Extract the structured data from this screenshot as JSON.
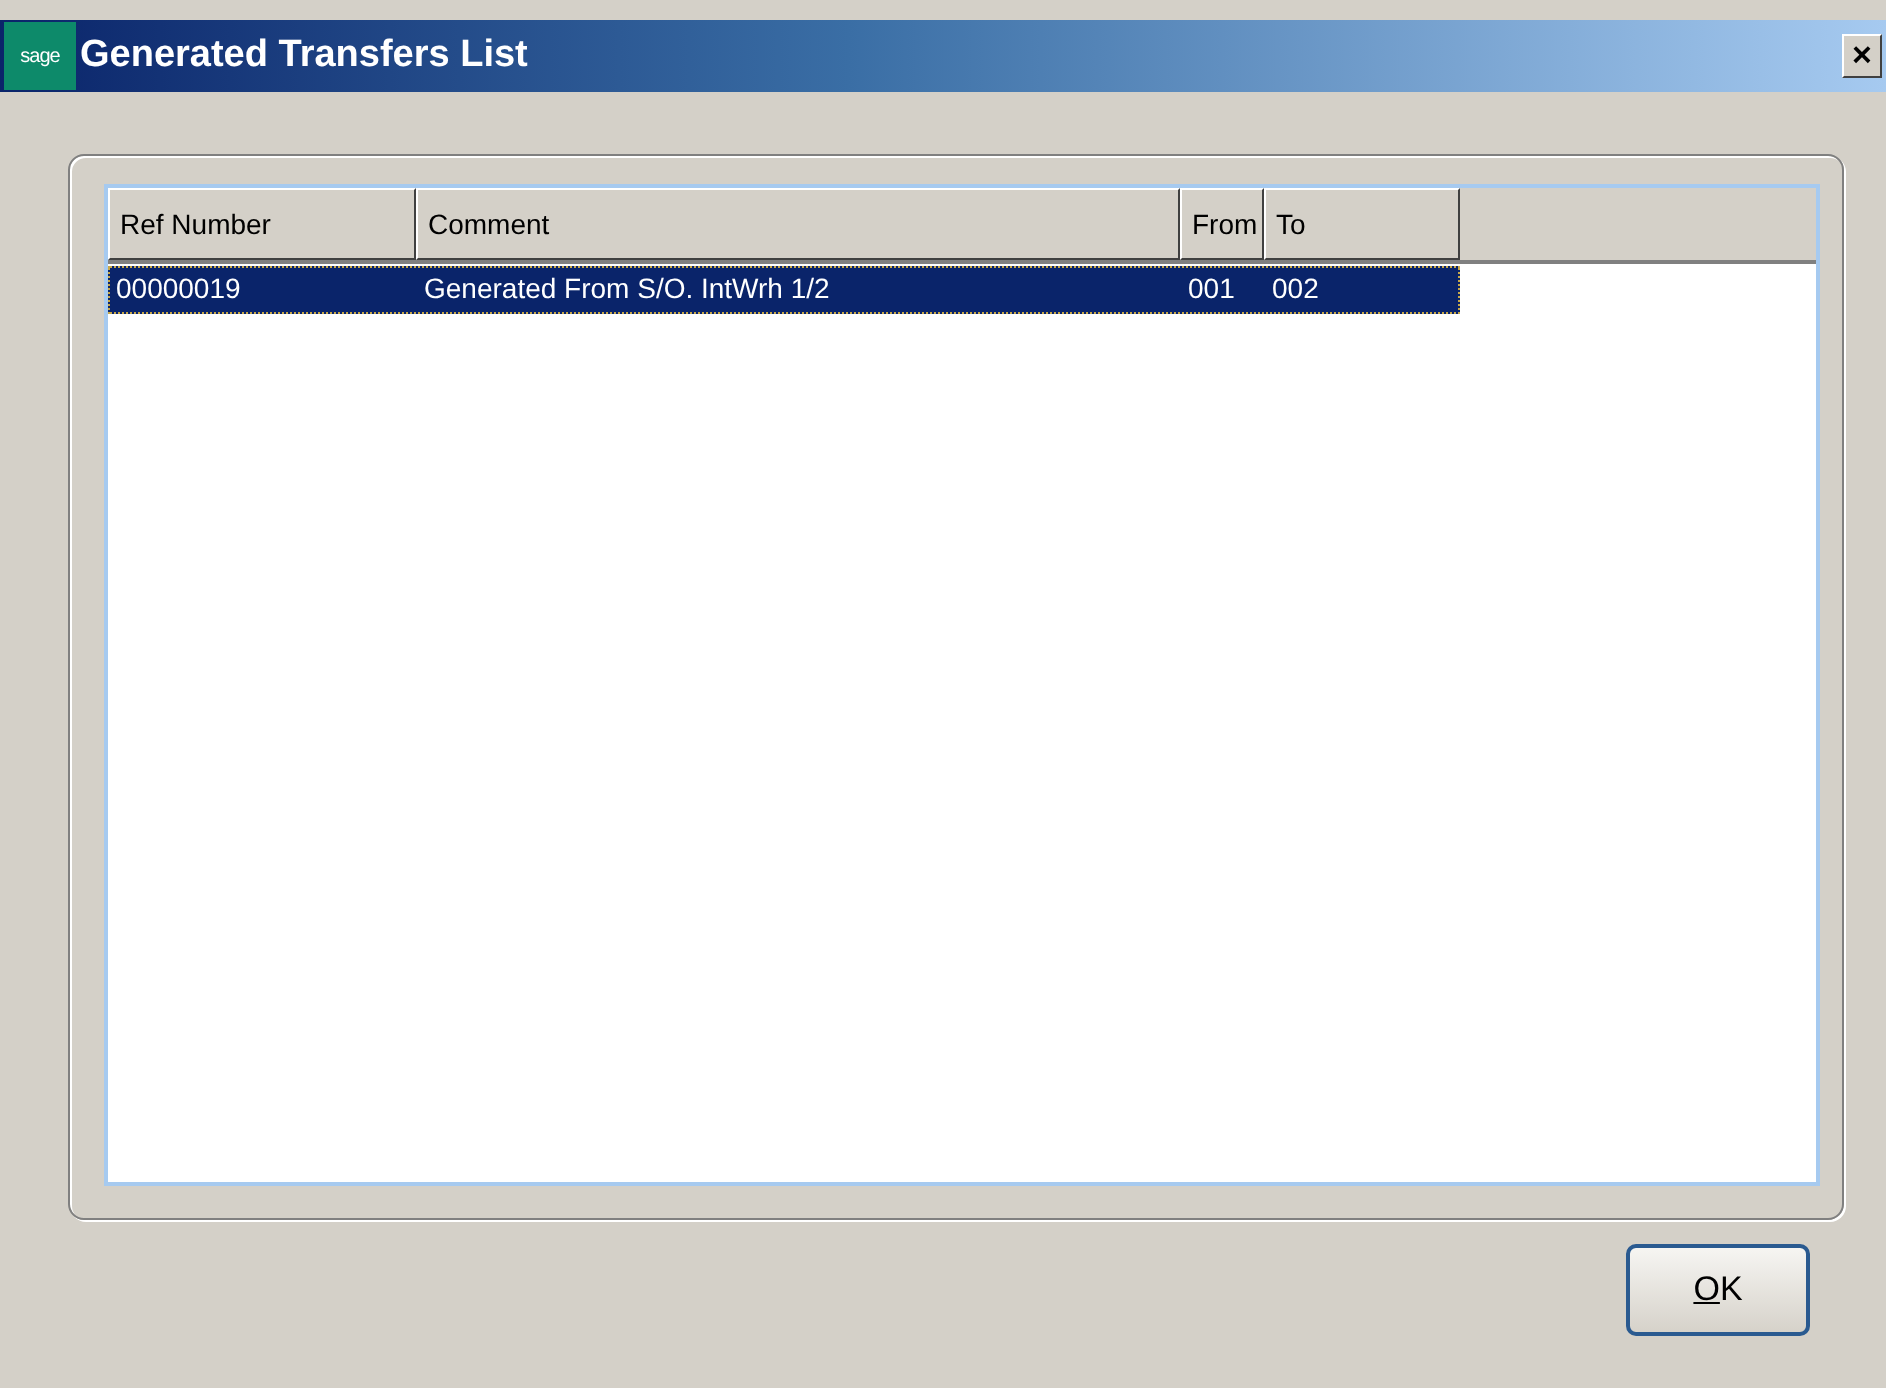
{
  "window": {
    "logo": "sage",
    "title": "Generated Transfers List",
    "close": "×"
  },
  "table": {
    "columns": [
      {
        "label": "Ref Number"
      },
      {
        "label": "Comment"
      },
      {
        "label": "From"
      },
      {
        "label": "To"
      }
    ],
    "rows": [
      {
        "selected": true,
        "cells": [
          "00000019",
          "Generated From S/O. IntWrh 1/2",
          "001",
          "002"
        ]
      }
    ]
  },
  "buttons": [
    {
      "label": "OK",
      "mnemonic_underlined": true
    }
  ]
}
